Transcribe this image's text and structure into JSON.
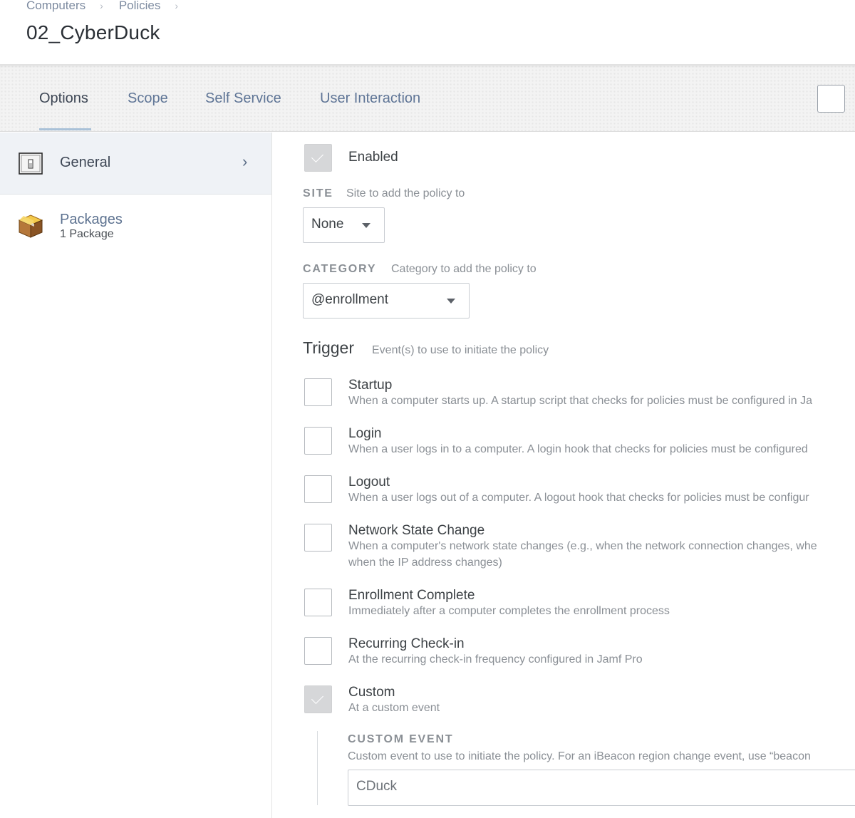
{
  "header": {
    "breadcrumb": [
      "Computers",
      "Policies"
    ],
    "separator": "›",
    "title": "02_CyberDuck"
  },
  "tabs": [
    {
      "label": "Options",
      "active": true
    },
    {
      "label": "Scope",
      "active": false
    },
    {
      "label": "Self Service",
      "active": false
    },
    {
      "label": "User Interaction",
      "active": false
    }
  ],
  "sidebar": {
    "items": [
      {
        "label": "General",
        "icon": "switch-icon",
        "selected": true
      },
      {
        "label": "Packages",
        "sub": "1 Package",
        "icon": "package-box-icon",
        "selected": false
      }
    ]
  },
  "general": {
    "enabled_label": "Enabled",
    "enabled_checked": true,
    "site": {
      "label": "SITE",
      "hint": "Site to add the policy to",
      "value": "None"
    },
    "category": {
      "label": "CATEGORY",
      "hint": "Category to add the policy to",
      "value": "@enrollment"
    },
    "trigger": {
      "title": "Trigger",
      "hint": "Event(s) to use to initiate the policy",
      "items": [
        {
          "label": "Startup",
          "desc": "When a computer starts up. A startup script that checks for policies must be configured in Ja",
          "checked": false
        },
        {
          "label": "Login",
          "desc": "When a user logs in to a computer. A login hook that checks for policies must be configured",
          "checked": false
        },
        {
          "label": "Logout",
          "desc": "When a user logs out of a computer. A logout hook that checks for policies must be configur",
          "checked": false
        },
        {
          "label": "Network State Change",
          "desc": "When a computer's network state changes (e.g., when the network connection changes, whe",
          "desc2": "when the IP address changes)",
          "checked": false
        },
        {
          "label": "Enrollment Complete",
          "desc": "Immediately after a computer completes the enrollment process",
          "checked": false
        },
        {
          "label": "Recurring Check-in",
          "desc": "At the recurring check-in frequency configured in Jamf Pro",
          "checked": false
        },
        {
          "label": "Custom",
          "desc": "At a custom event",
          "checked": true
        }
      ]
    },
    "custom_event": {
      "label": "CUSTOM EVENT",
      "hint": "Custom event to use to initiate the policy. For an iBeacon region change event, use “beacon",
      "value": "CDuck"
    }
  }
}
